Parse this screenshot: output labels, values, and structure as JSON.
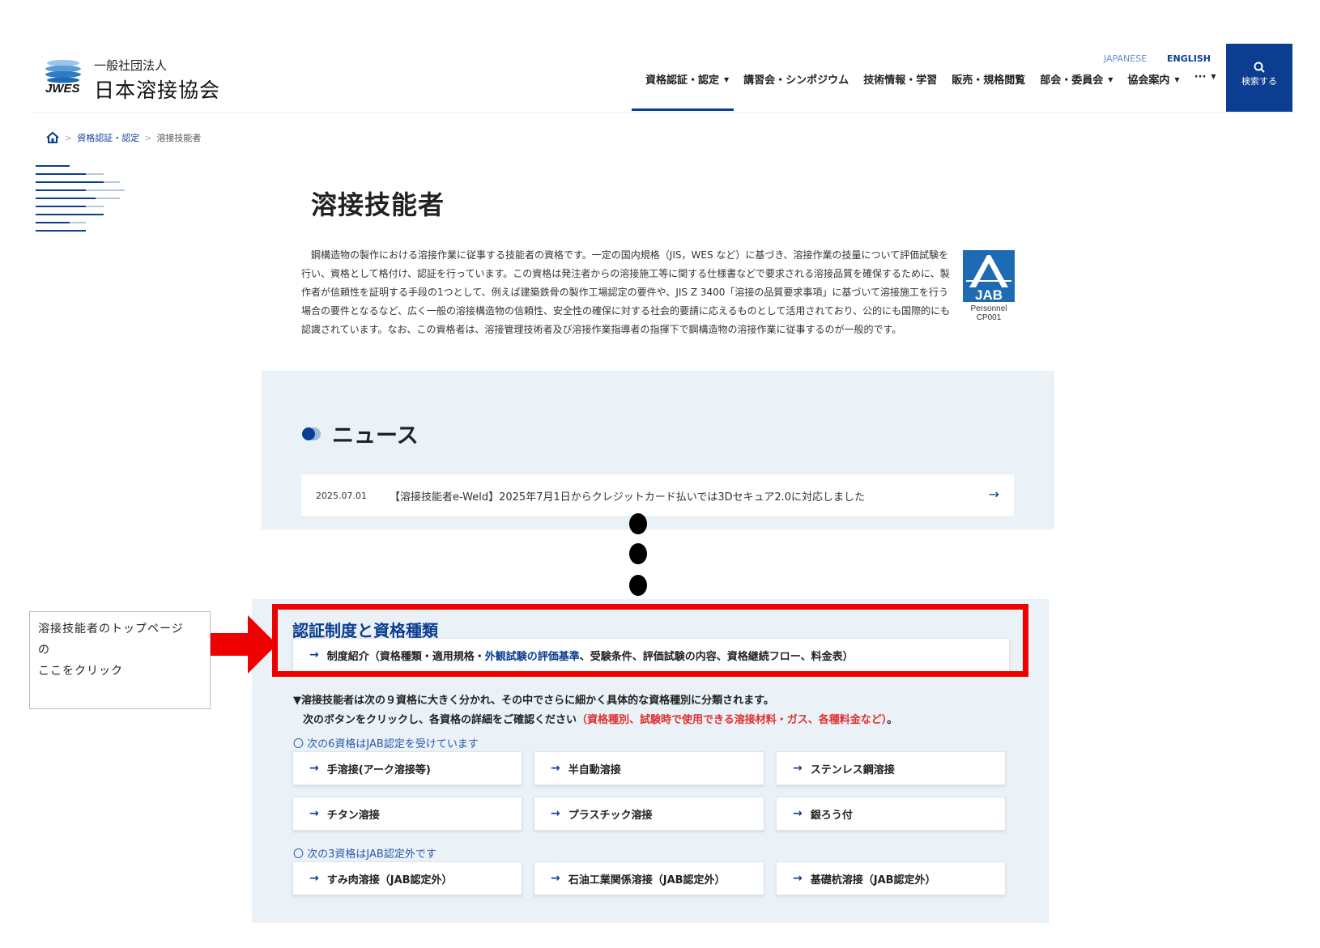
{
  "header": {
    "logo_small": "一般社団法人",
    "logo_main": "日本溶接協会",
    "lang_japanese": "JAPANESE",
    "lang_english": "ENGLISH",
    "search_label": "検索する",
    "nav": [
      {
        "label": "資格認証・認定",
        "caret": "▼"
      },
      {
        "label": "講習会・シンポジウム",
        "caret": ""
      },
      {
        "label": "技術情報・学習",
        "caret": ""
      },
      {
        "label": "販売・規格閲覧",
        "caret": ""
      },
      {
        "label": "部会・委員会",
        "caret": "▼"
      },
      {
        "label": "協会案内",
        "caret": "▼"
      },
      {
        "label": "···",
        "caret": "▼"
      }
    ]
  },
  "breadcrumb": {
    "level1": "資格認証・認定",
    "current": "溶接技能者",
    "sep": ">"
  },
  "page": {
    "title": "溶接技能者",
    "intro": "鋼構造物の製作における溶接作業に従事する技能者の資格です。一定の国内規格（JIS，WES など）に基づき、溶接作業の技量について評価試験を行い、資格として格付け、認証を行っています。この資格は発注者からの溶接施工等に関する仕様書などで要求される溶接品質を確保するために、製作者が信頼性を証明する手段の1つとして、例えば建築鉄骨の製作工場認定の要件や、JIS Z 3400「溶接の品質要求事項」に基づいて溶接施工を行う場合の要件となるなど、広く一般の溶接構造物の信頼性、安全性の確保に対する社会的要請に応えるものとして活用されており、公的にも国際的にも認識されています。なお、この資格者は、溶接管理技術者及び溶接作業指導者の指揮下で鋼構造物の溶接作業に従事するのが一般的です。",
    "jab_line1": "Personnel",
    "jab_line2": "CP001"
  },
  "news": {
    "heading": "ニュース",
    "items": [
      {
        "date": "2025.07.01",
        "text": "【溶接技能者e-Weld】2025年7月1日からクレジットカード払いでは3Dセキュア2.0に対応しました"
      }
    ]
  },
  "certification": {
    "heading": "認証制度と資格種類",
    "intro_button": {
      "part1": "制度紹介（資格種類・適用規格・",
      "part2": "外観試験の評価基準",
      "part3": "、受験条件、評価試験の内容、資格継続フロー、料金表）"
    },
    "note_line1": "▼溶接技能者は次の９資格に大きく分かれ、その中でさらに細かく具体的な資格種別に分類されます。",
    "note_line2": "次のボタンをクリックし、各資格の詳細をご確認ください",
    "note_line2_red": "（資格種別、試験時で使用できる溶接材料・ガス、各種料金など）",
    "note_line2_end": "。",
    "jab_label": "〇 次の6資格はJAB認定を受けています",
    "jab_buttons": [
      "手溶接(アーク溶接等)",
      "半自動溶接",
      "ステンレス鋼溶接",
      "チタン溶接",
      "プラスチック溶接",
      "銀ろう付"
    ],
    "nonjab_label": "〇 次の3資格はJAB認定外です",
    "nonjab_buttons": [
      "すみ肉溶接（JAB認定外）",
      "石油工業関係溶接（JAB認定外）",
      "基礎杭溶接（JAB認定外）"
    ]
  },
  "callout": {
    "line1": "溶接技能者のトップページ",
    "line2": "の",
    "line3": "ここをクリック"
  }
}
